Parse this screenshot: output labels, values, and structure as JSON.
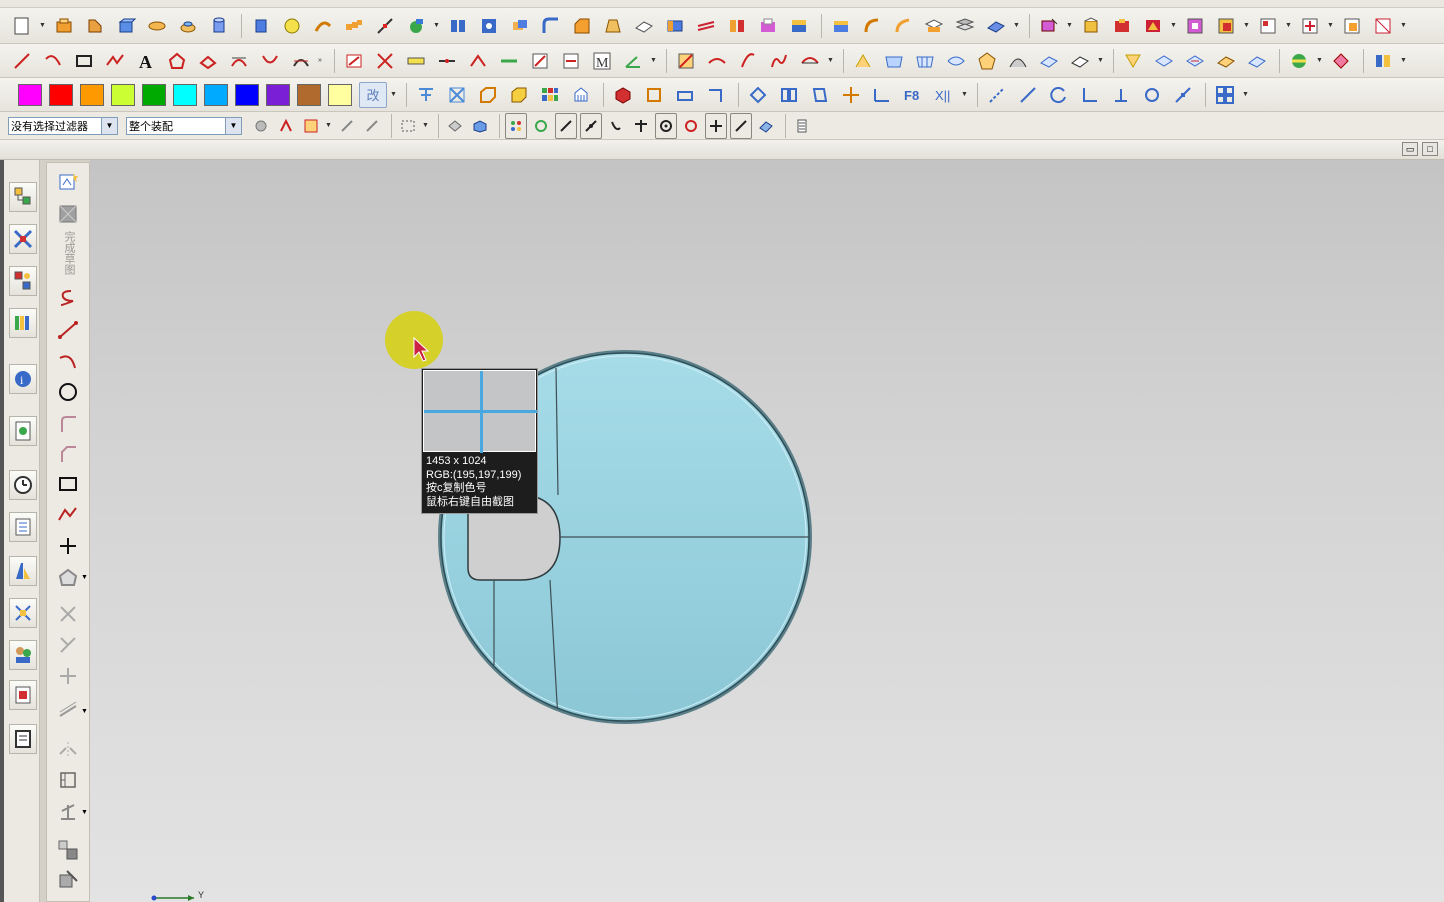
{
  "colors": {
    "toolbar_bg": "#e6e4dc",
    "viewport_top": "#c4c4c4",
    "viewport_bottom": "#e3e3e3",
    "part_fill": "#a6d8e2",
    "crosshair": "#4aa8e0"
  },
  "palette": [
    "#ff00ff",
    "#ff0000",
    "#ff9900",
    "#ccff33",
    "#00aa00",
    "#00ffff",
    "#00aaff",
    "#0000ff",
    "#7a1fd6",
    "#b06a2e",
    "#ffffa0"
  ],
  "palette_extra_label": "改",
  "selection_bar": {
    "filter_value": "没有选择过滤器",
    "scope_value": "整个装配"
  },
  "sketch_toolbar": {
    "finish_label": "完成草图"
  },
  "magnifier": {
    "size_text": "1453 x 1024",
    "rgb_text": "RGB:(195,197,199)",
    "hint_copy": "按c复制色号",
    "hint_capture": "鼠标右键自由截图"
  },
  "axis": {
    "y_label": "Y"
  }
}
